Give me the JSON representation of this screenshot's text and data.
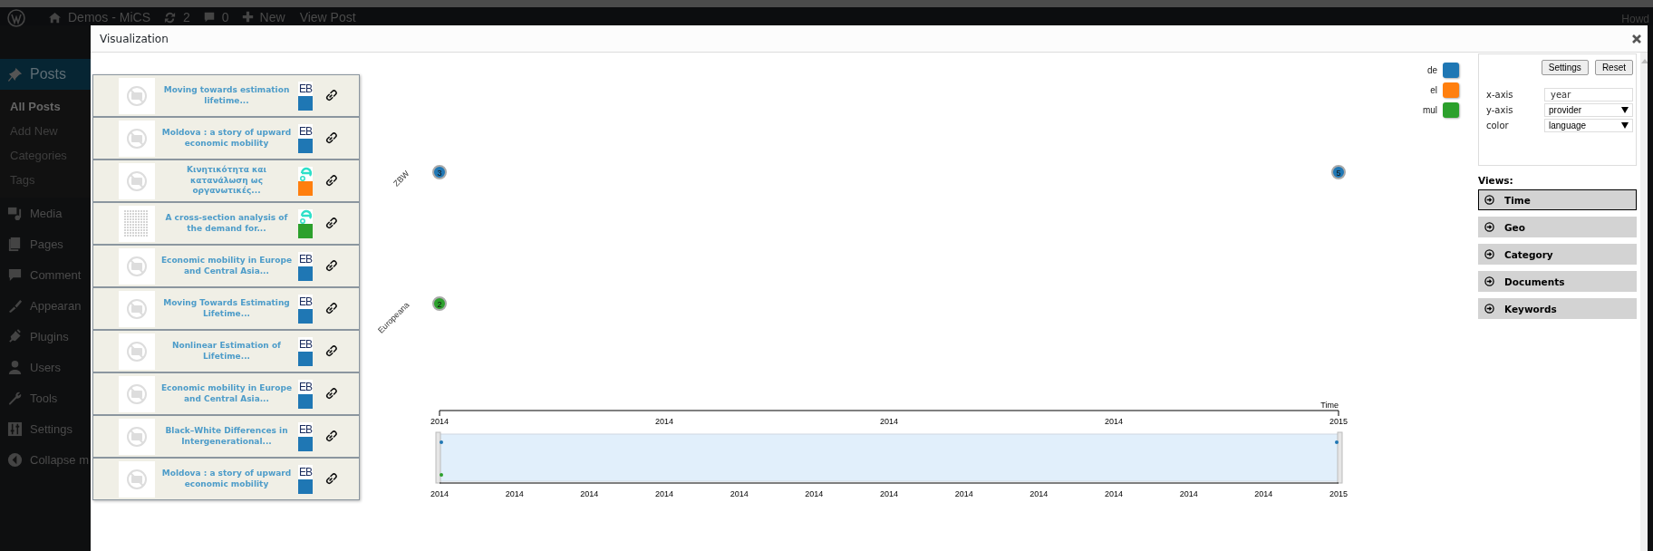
{
  "admin_bar": {
    "site": "Demos - MiCS",
    "updates": "2",
    "comments": "0",
    "new": "New",
    "view_post": "View Post",
    "greeting": "Howd"
  },
  "sidebar": {
    "items": [
      {
        "label": "Posts",
        "selected": true,
        "children": [
          {
            "label": "All Posts",
            "selected": true
          },
          {
            "label": "Add New",
            "selected": false
          },
          {
            "label": "Categories",
            "selected": false
          },
          {
            "label": "Tags",
            "selected": false
          }
        ]
      },
      {
        "label": "Media",
        "selected": false
      },
      {
        "label": "Pages",
        "selected": false
      },
      {
        "label": "Comment",
        "selected": false
      },
      {
        "label": "Appearan",
        "selected": false
      },
      {
        "label": "Plugins",
        "selected": false
      },
      {
        "label": "Users",
        "selected": false
      },
      {
        "label": "Tools",
        "selected": false
      },
      {
        "label": "Settings",
        "selected": false
      },
      {
        "label": "Collapse m",
        "selected": false
      }
    ]
  },
  "modal": {
    "title": "Visualization"
  },
  "documents": [
    {
      "title": "Moving towards estimation lifetime...",
      "scanned": false,
      "kind": "eb",
      "badge": "EB",
      "color": "#1f77b4"
    },
    {
      "title": "Moldova : a story of upward economic mobility",
      "scanned": false,
      "kind": "eb",
      "badge": "EB",
      "color": "#1f77b4"
    },
    {
      "title": "Κινητικότητα και κατανάλωση ως οργανωτικές...",
      "scanned": false,
      "kind": "europeana",
      "color": "#ff7f0e"
    },
    {
      "title": "A cross-section analysis of the demand for...",
      "scanned": true,
      "kind": "europeana",
      "color": "#2ca02c"
    },
    {
      "title": "Economic mobility in Europe and Central Asia...",
      "scanned": false,
      "kind": "eb",
      "badge": "EB",
      "color": "#1f77b4"
    },
    {
      "title": "Moving Towards Estimating Lifetime...",
      "scanned": false,
      "kind": "eb",
      "badge": "EB",
      "color": "#1f77b4"
    },
    {
      "title": "Nonlinear Estimation of Lifetime...",
      "scanned": false,
      "kind": "eb",
      "badge": "EB",
      "color": "#1f77b4"
    },
    {
      "title": "Economic mobility in Europe and Central Asia...",
      "scanned": false,
      "kind": "eb",
      "badge": "EB",
      "color": "#1f77b4"
    },
    {
      "title": "Black–White Differences in Intergenerational...",
      "scanned": false,
      "kind": "eb",
      "badge": "EB",
      "color": "#1f77b4"
    },
    {
      "title": "Moldova : a story of upward economic mobility",
      "scanned": false,
      "kind": "eb",
      "badge": "EB",
      "color": "#1f77b4"
    }
  ],
  "legend": [
    {
      "label": "de",
      "color": "#1f77b4"
    },
    {
      "label": "el",
      "color": "#ff7f0e"
    },
    {
      "label": "mul",
      "color": "#2ca02c"
    }
  ],
  "plot": {
    "axis_title": "Time",
    "axis_ticks": [
      "2014",
      "2014",
      "2014",
      "2014",
      "2015"
    ],
    "rows": [
      {
        "label": "ZBW",
        "first_tick": {
          "label": "3",
          "color": "#1f77b4"
        },
        "last_tick": {
          "label": "5",
          "color": "#1f77b4"
        }
      },
      {
        "label": "Europeana",
        "first_tick": {
          "label": "2",
          "color": "#2ca02c"
        }
      }
    ]
  },
  "timeline": {
    "ticks": [
      "2014",
      "2014",
      "2014",
      "2014",
      "2014",
      "2014",
      "2014",
      "2014",
      "2014",
      "2014",
      "2014",
      "2014",
      "2015"
    ]
  },
  "settings": {
    "buttons": [
      "Settings",
      "Reset"
    ],
    "fields": [
      {
        "label": "x-axis",
        "kind": "text",
        "value": "year"
      },
      {
        "label": "y-axis",
        "kind": "select",
        "value": "provider"
      },
      {
        "label": "color",
        "kind": "select",
        "value": "language"
      }
    ]
  },
  "views": {
    "heading": "Views:",
    "items": [
      {
        "label": "Time",
        "selected": true
      },
      {
        "label": "Geo",
        "selected": false
      },
      {
        "label": "Category",
        "selected": false
      },
      {
        "label": "Documents",
        "selected": false
      },
      {
        "label": "Keywords",
        "selected": false
      }
    ]
  }
}
